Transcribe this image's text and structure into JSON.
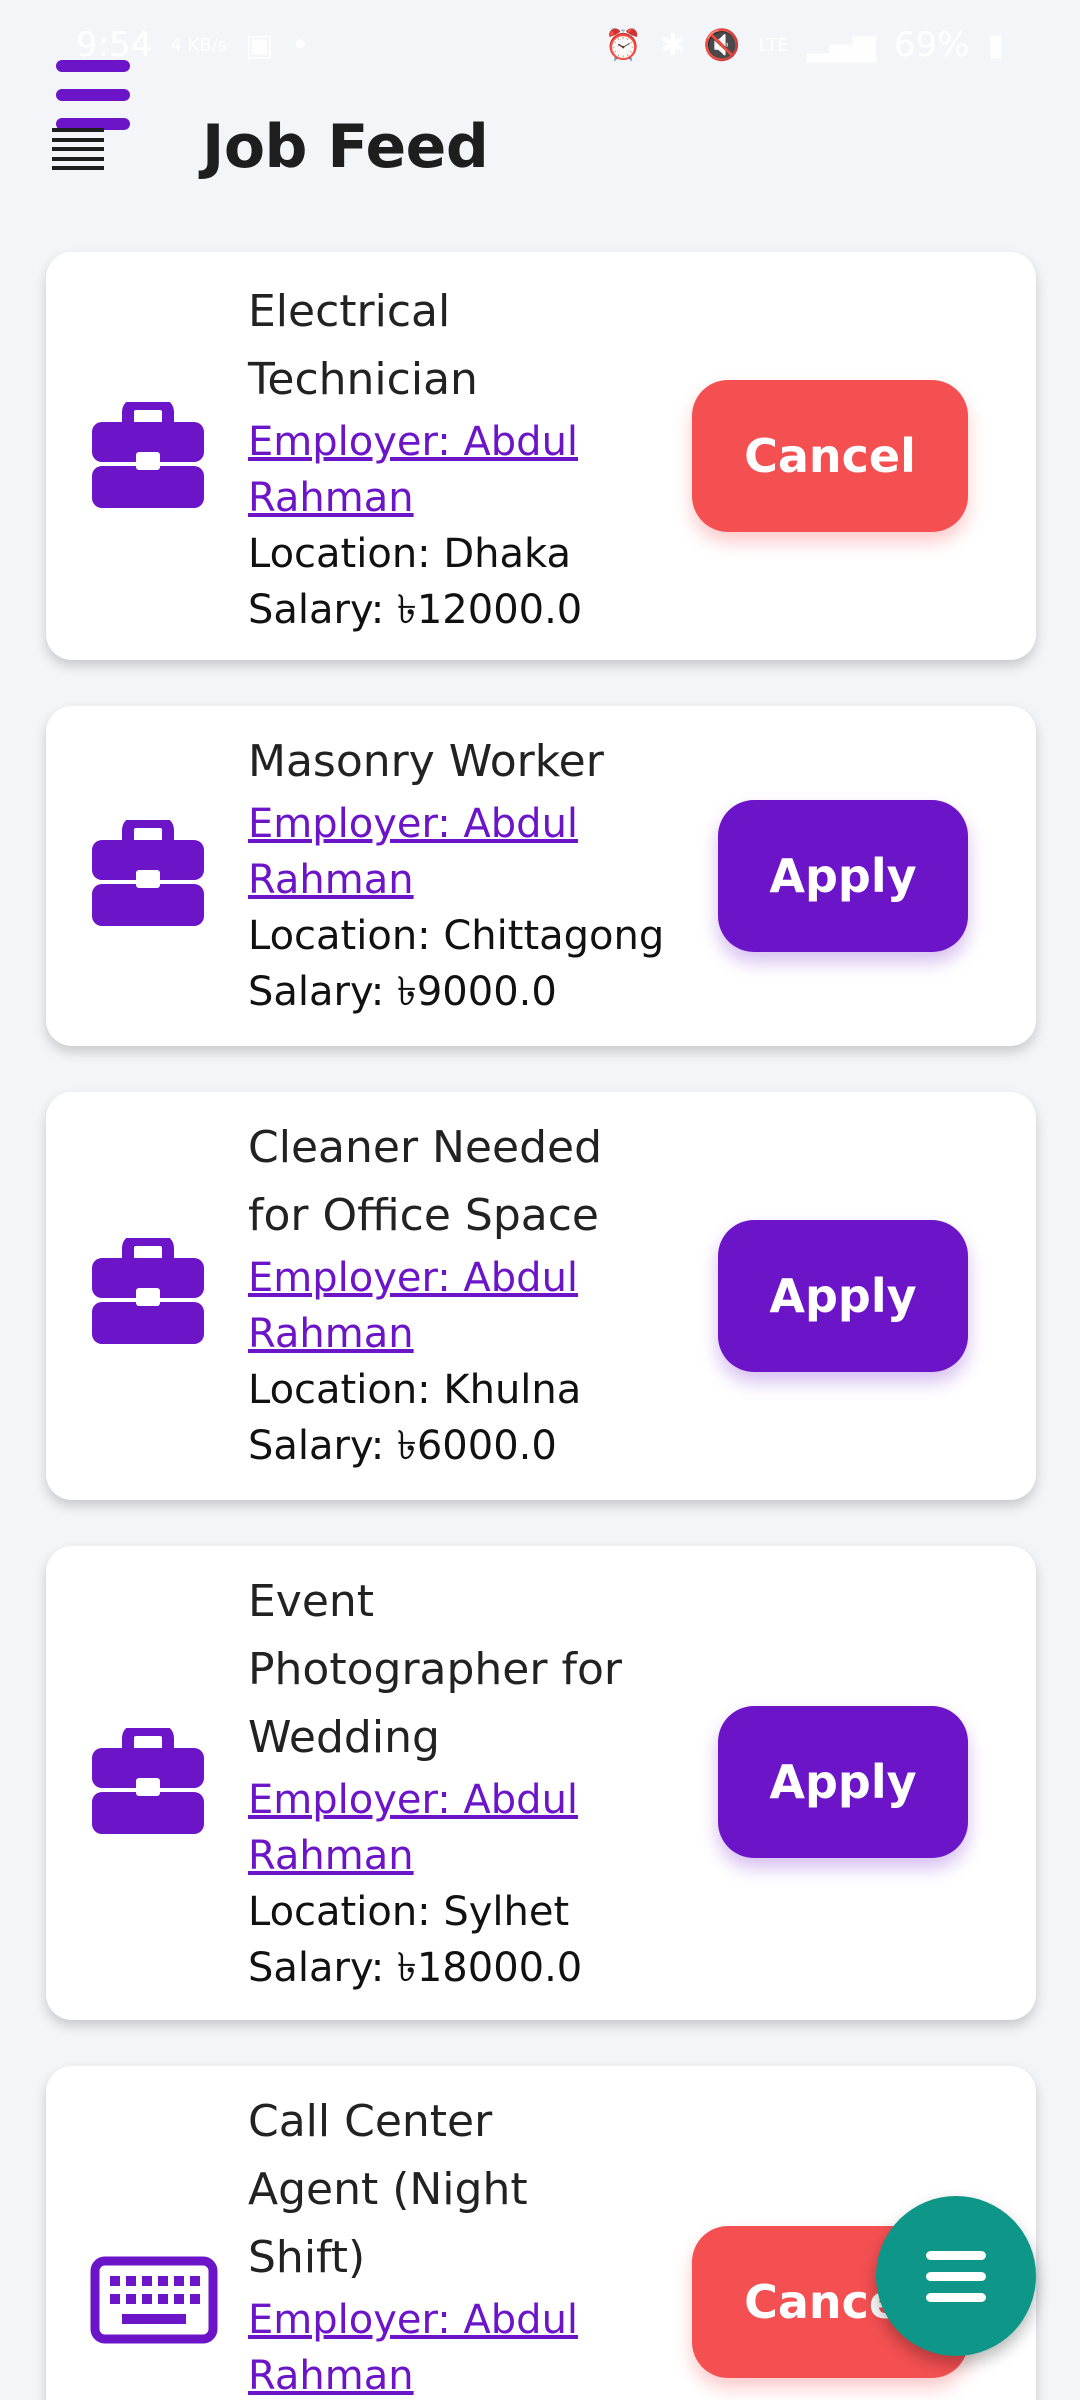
{
  "status_bar": {
    "time": "9:54",
    "net_speed": "4 KB/s",
    "battery": "69%",
    "network_type": "LTE"
  },
  "header": {
    "title": "Job Feed"
  },
  "jobs": [
    {
      "title_lines": [
        "Electrical",
        "Technician"
      ],
      "employer_lines": [
        "Employer: Abdul",
        "Rahman"
      ],
      "location": "Location: Dhaka",
      "salary": "Salary: ৳12000.0",
      "action": "Cancel",
      "icon": "briefcase-icon"
    },
    {
      "title_lines": [
        "Masonry Worker"
      ],
      "employer_lines": [
        "Employer: Abdul",
        "Rahman"
      ],
      "location": "Location: Chittagong",
      "salary": "Salary: ৳9000.0",
      "action": "Apply",
      "icon": "briefcase-icon"
    },
    {
      "title_lines": [
        "Cleaner Needed",
        "for Office Space"
      ],
      "employer_lines": [
        "Employer: Abdul",
        "Rahman"
      ],
      "location": "Location: Khulna",
      "salary": "Salary: ৳6000.0",
      "action": "Apply",
      "icon": "briefcase-icon"
    },
    {
      "title_lines": [
        "Event",
        "Photographer for",
        "Wedding"
      ],
      "employer_lines": [
        "Employer: Abdul",
        "Rahman"
      ],
      "location": "Location: Sylhet",
      "salary": "Salary: ৳18000.0",
      "action": "Apply",
      "icon": "briefcase-icon"
    },
    {
      "title_lines": [
        "Call Center",
        "Agent (Night",
        "Shift)"
      ],
      "employer_lines": [
        "Employer: Abdul",
        "Rahman"
      ],
      "location": "",
      "salary": "",
      "action": "Cancel",
      "icon": "keyboard-icon"
    }
  ],
  "colors": {
    "accent": "#6c14c8",
    "cancel": "#f45052",
    "fab": "#0e9688",
    "background": "#f4f5f9"
  },
  "fab": {
    "icon": "menu-icon"
  }
}
